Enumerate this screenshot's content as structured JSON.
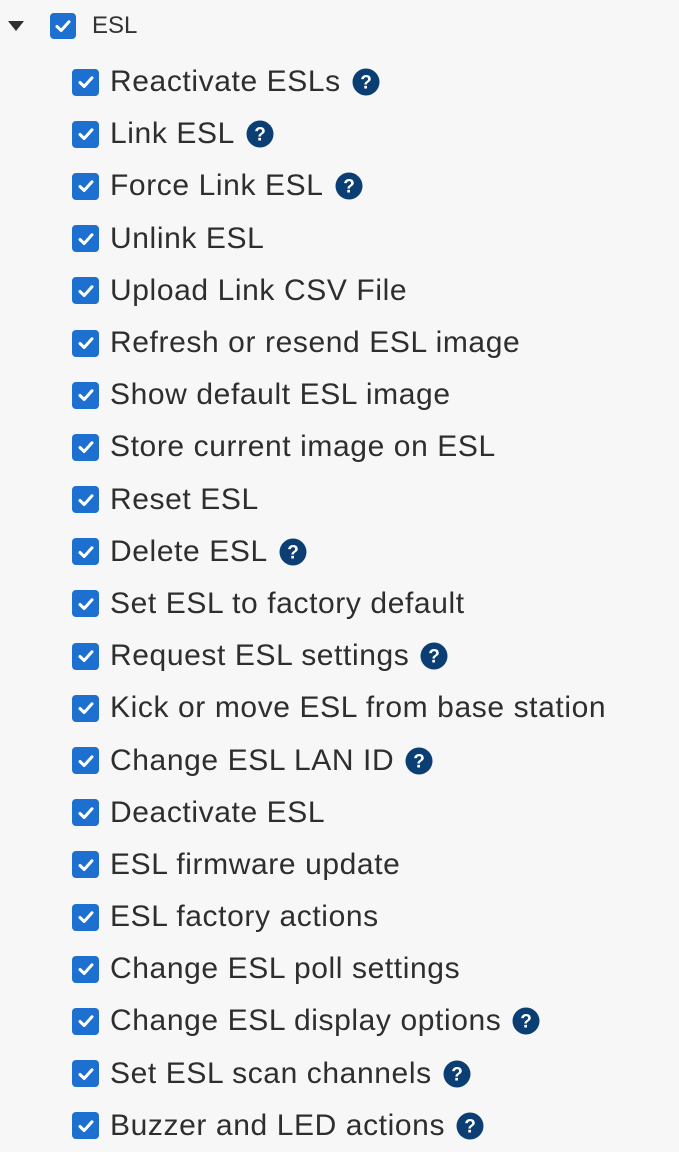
{
  "tree": {
    "parent": {
      "label": "ESL",
      "expanded": true,
      "checked": true,
      "caret_icon": "caret-down-icon",
      "checkbox_icon": "checkmark-icon"
    },
    "items": [
      {
        "label": "Reactivate ESLs",
        "checked": true,
        "help": true
      },
      {
        "label": "Link ESL",
        "checked": true,
        "help": true
      },
      {
        "label": "Force Link ESL",
        "checked": true,
        "help": true
      },
      {
        "label": "Unlink ESL",
        "checked": true,
        "help": false
      },
      {
        "label": "Upload Link CSV File",
        "checked": true,
        "help": false
      },
      {
        "label": "Refresh or resend ESL image",
        "checked": true,
        "help": false
      },
      {
        "label": "Show default ESL image",
        "checked": true,
        "help": false
      },
      {
        "label": "Store current image on ESL",
        "checked": true,
        "help": false
      },
      {
        "label": "Reset ESL",
        "checked": true,
        "help": false
      },
      {
        "label": "Delete ESL",
        "checked": true,
        "help": true
      },
      {
        "label": "Set ESL to factory default",
        "checked": true,
        "help": false
      },
      {
        "label": "Request ESL settings",
        "checked": true,
        "help": true
      },
      {
        "label": "Kick or move ESL from base station",
        "checked": true,
        "help": false
      },
      {
        "label": "Change ESL LAN ID",
        "checked": true,
        "help": true
      },
      {
        "label": "Deactivate ESL",
        "checked": true,
        "help": false
      },
      {
        "label": "ESL firmware update",
        "checked": true,
        "help": false
      },
      {
        "label": "ESL factory actions",
        "checked": true,
        "help": false
      },
      {
        "label": "Change ESL poll settings",
        "checked": true,
        "help": false
      },
      {
        "label": "Change ESL display options",
        "checked": true,
        "help": true
      },
      {
        "label": "Set ESL scan channels",
        "checked": true,
        "help": true
      },
      {
        "label": "Buzzer and LED actions",
        "checked": true,
        "help": true
      }
    ]
  },
  "colors": {
    "checkbox_fill": "#1d6fd0",
    "help_icon_fill": "#0b3f73",
    "background": "#f7f7f7",
    "text": "#2e2e2e"
  },
  "icons": {
    "help": "question-circle-icon",
    "check": "checkmark-icon"
  }
}
